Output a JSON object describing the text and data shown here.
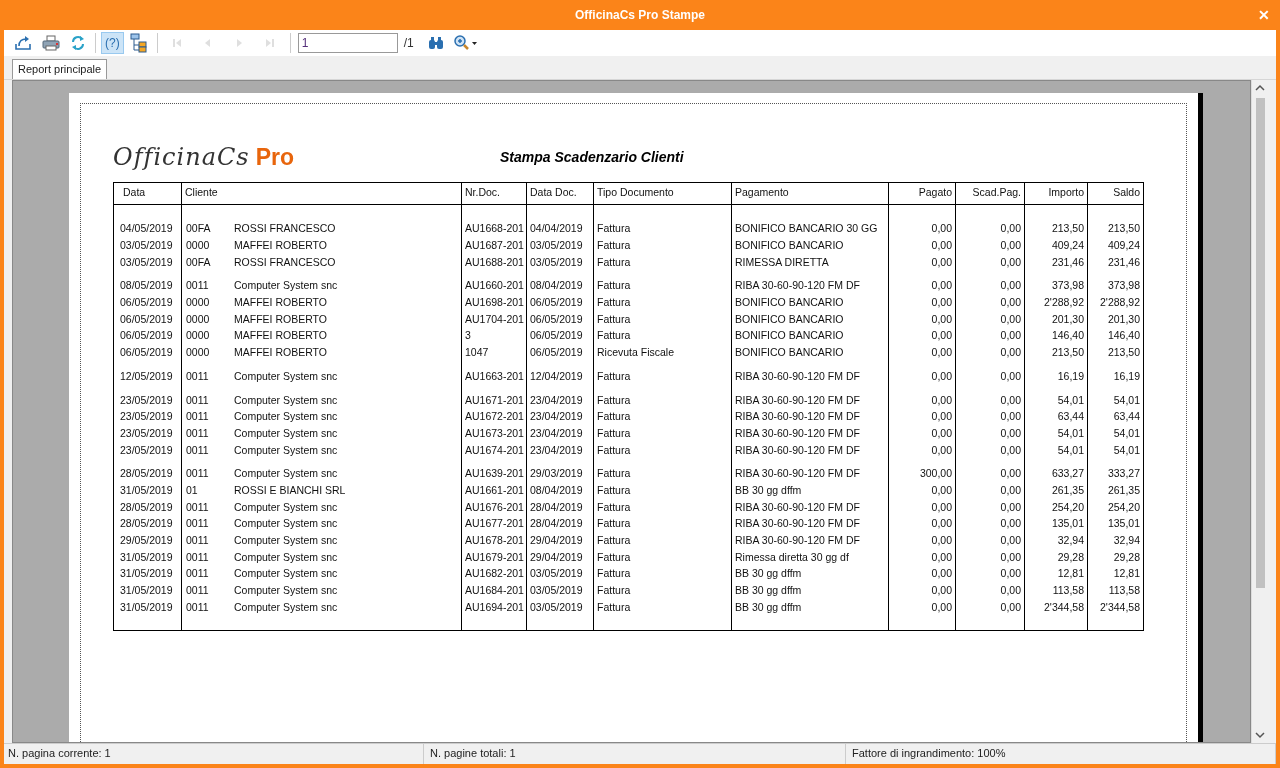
{
  "window": {
    "title": "OfficinaCs Pro Stampe",
    "close": "✕"
  },
  "toolbar": {
    "left_buttons": [
      {
        "kind": "export",
        "disabled": false,
        "pressed": false
      },
      {
        "kind": "print",
        "disabled": false,
        "pressed": false
      },
      {
        "kind": "refresh",
        "disabled": false,
        "pressed": false
      },
      {
        "kind": "help",
        "label": "(?)",
        "disabled": false,
        "pressed": true
      },
      {
        "kind": "tree",
        "disabled": false,
        "pressed": false
      },
      {
        "kind": "first",
        "disabled": true,
        "pressed": false
      },
      {
        "kind": "prev",
        "disabled": true,
        "pressed": false
      },
      {
        "kind": "next",
        "disabled": true,
        "pressed": false
      },
      {
        "kind": "last",
        "disabled": true,
        "pressed": false
      }
    ],
    "page_field": {
      "value": "1",
      "total": "/1"
    },
    "right_buttons": [
      {
        "kind": "find",
        "disabled": false,
        "pressed": false
      },
      {
        "kind": "zoom",
        "disabled": false,
        "pressed": false
      }
    ]
  },
  "tabs": [
    {
      "label": "Report principale",
      "selected": true
    }
  ],
  "report": {
    "logo": {
      "script": "OfficinaCs",
      "suffix": "Pro"
    },
    "title": "Stampa Scadenzario Clienti",
    "columns": [
      "Data",
      "Cliente",
      "Nr.Doc.",
      "Data Doc.",
      "Tipo Documento",
      "Pagamento",
      "Pagato",
      "Scad.Pag.",
      "Importo",
      "Saldo"
    ],
    "groups": [
      {
        "rows": [
          [
            "04/05/2019",
            {
              "code": "00FA",
              "name": "ROSSI FRANCESCO"
            },
            "AU1668-201",
            "04/04/2019",
            "Fattura",
            "BONIFICO BANCARIO 30 GG",
            "0,00",
            "0,00",
            "213,50",
            "213,50"
          ],
          [
            "03/05/2019",
            {
              "code": "0000",
              "name": "MAFFEI ROBERTO"
            },
            "AU1687-201",
            "03/05/2019",
            "Fattura",
            "BONIFICO BANCARIO",
            "0,00",
            "0,00",
            "409,24",
            "409,24"
          ],
          [
            "03/05/2019",
            {
              "code": "00FA",
              "name": "ROSSI FRANCESCO"
            },
            "AU1688-201",
            "03/05/2019",
            "Fattura",
            "RIMESSA DIRETTA",
            "0,00",
            "0,00",
            "231,46",
            "231,46"
          ]
        ]
      },
      {
        "rows": [
          [
            "08/05/2019",
            {
              "code": "0011",
              "name": "Computer System snc"
            },
            "AU1660-201",
            "08/04/2019",
            "Fattura",
            "RIBA 30-60-90-120 FM DF",
            "0,00",
            "0,00",
            "373,98",
            "373,98"
          ],
          [
            "06/05/2019",
            {
              "code": "0000",
              "name": "MAFFEI ROBERTO"
            },
            "AU1698-201",
            "06/05/2019",
            "Fattura",
            "BONIFICO BANCARIO",
            "0,00",
            "0,00",
            "2'288,92",
            "2'288,92"
          ],
          [
            "06/05/2019",
            {
              "code": "0000",
              "name": "MAFFEI ROBERTO"
            },
            "AU1704-201",
            "06/05/2019",
            "Fattura",
            "BONIFICO BANCARIO",
            "0,00",
            "0,00",
            "201,30",
            "201,30"
          ],
          [
            "06/05/2019",
            {
              "code": "0000",
              "name": "MAFFEI ROBERTO"
            },
            "3",
            "06/05/2019",
            "Fattura",
            "BONIFICO BANCARIO",
            "0,00",
            "0,00",
            "146,40",
            "146,40"
          ],
          [
            "06/05/2019",
            {
              "code": "0000",
              "name": "MAFFEI ROBERTO"
            },
            "1047",
            "06/05/2019",
            "Ricevuta Fiscale",
            "BONIFICO BANCARIO",
            "0,00",
            "0,00",
            "213,50",
            "213,50"
          ]
        ]
      },
      {
        "rows": [
          [
            "12/05/2019",
            {
              "code": "0011",
              "name": "Computer System snc"
            },
            "AU1663-201",
            "12/04/2019",
            "Fattura",
            "RIBA 30-60-90-120 FM DF",
            "0,00",
            "0,00",
            "16,19",
            "16,19"
          ]
        ]
      },
      {
        "rows": [
          [
            "23/05/2019",
            {
              "code": "0011",
              "name": "Computer System snc"
            },
            "AU1671-201",
            "23/04/2019",
            "Fattura",
            "RIBA 30-60-90-120 FM DF",
            "0,00",
            "0,00",
            "54,01",
            "54,01"
          ],
          [
            "23/05/2019",
            {
              "code": "0011",
              "name": "Computer System snc"
            },
            "AU1672-201",
            "23/04/2019",
            "Fattura",
            "RIBA 30-60-90-120 FM DF",
            "0,00",
            "0,00",
            "63,44",
            "63,44"
          ],
          [
            "23/05/2019",
            {
              "code": "0011",
              "name": "Computer System snc"
            },
            "AU1673-201",
            "23/04/2019",
            "Fattura",
            "RIBA 30-60-90-120 FM DF",
            "0,00",
            "0,00",
            "54,01",
            "54,01"
          ],
          [
            "23/05/2019",
            {
              "code": "0011",
              "name": "Computer System snc"
            },
            "AU1674-201",
            "23/04/2019",
            "Fattura",
            "RIBA 30-60-90-120 FM DF",
            "0,00",
            "0,00",
            "54,01",
            "54,01"
          ]
        ]
      },
      {
        "rows": [
          [
            "28/05/2019",
            {
              "code": "0011",
              "name": "Computer System snc"
            },
            "AU1639-201",
            "29/03/2019",
            "Fattura",
            "RIBA 30-60-90-120 FM DF",
            "300,00",
            "0,00",
            "633,27",
            "333,27"
          ],
          [
            "31/05/2019",
            {
              "code": "01",
              "name": "ROSSI E BIANCHI SRL"
            },
            "AU1661-201",
            "08/04/2019",
            "Fattura",
            "BB 30 gg dffm",
            "0,00",
            "0,00",
            "261,35",
            "261,35"
          ],
          [
            "28/05/2019",
            {
              "code": "0011",
              "name": "Computer System snc"
            },
            "AU1676-201",
            "28/04/2019",
            "Fattura",
            "RIBA 30-60-90-120 FM DF",
            "0,00",
            "0,00",
            "254,20",
            "254,20"
          ],
          [
            "28/05/2019",
            {
              "code": "0011",
              "name": "Computer System snc"
            },
            "AU1677-201",
            "28/04/2019",
            "Fattura",
            "RIBA 30-60-90-120 FM DF",
            "0,00",
            "0,00",
            "135,01",
            "135,01"
          ],
          [
            "29/05/2019",
            {
              "code": "0011",
              "name": "Computer System snc"
            },
            "AU1678-201",
            "29/04/2019",
            "Fattura",
            "RIBA 30-60-90-120 FM DF",
            "0,00",
            "0,00",
            "32,94",
            "32,94"
          ],
          [
            "31/05/2019",
            {
              "code": "0011",
              "name": "Computer System snc"
            },
            "AU1679-201",
            "29/04/2019",
            "Fattura",
            "Rimessa diretta 30 gg df",
            "0,00",
            "0,00",
            "29,28",
            "29,28"
          ],
          [
            "31/05/2019",
            {
              "code": "0011",
              "name": "Computer System snc"
            },
            "AU1682-201",
            "03/05/2019",
            "Fattura",
            "BB 30 gg dffm",
            "0,00",
            "0,00",
            "12,81",
            "12,81"
          ],
          [
            "31/05/2019",
            {
              "code": "0011",
              "name": "Computer System snc"
            },
            "AU1684-201",
            "03/05/2019",
            "Fattura",
            "BB 30 gg dffm",
            "0,00",
            "0,00",
            "113,58",
            "113,58"
          ],
          [
            "31/05/2019",
            {
              "code": "0011",
              "name": "Computer System snc"
            },
            "AU1694-201",
            "03/05/2019",
            "Fattura",
            "BB 30 gg dffm",
            "0,00",
            "0,00",
            "2'344,58",
            "2'344,58"
          ]
        ]
      }
    ]
  },
  "status_bar": [
    "N. pagina corrente: 1",
    "N. pagine totali: 1",
    "Fattore di ingrandimento: 100%"
  ]
}
